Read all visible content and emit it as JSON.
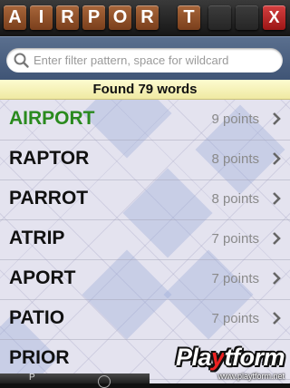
{
  "tiles": [
    "A",
    "I",
    "R",
    "P",
    "O",
    "R",
    "T"
  ],
  "close_label": "X",
  "search": {
    "placeholder": "Enter filter pattern, space for wildcard",
    "value": ""
  },
  "found_text": "Found 79 words",
  "words": [
    {
      "word": "AIRPORT",
      "points": "9 points",
      "highlight": true
    },
    {
      "word": "RAPTOR",
      "points": "8 points"
    },
    {
      "word": "PARROT",
      "points": "8 points"
    },
    {
      "word": "ATRIP",
      "points": "7 points"
    },
    {
      "word": "APORT",
      "points": "7 points"
    },
    {
      "word": "PATIO",
      "points": "7 points"
    },
    {
      "word": "PRIOR",
      "points": ""
    }
  ],
  "toolbar": {
    "partial_label": "P"
  },
  "watermark": {
    "logo_pre": "Pla",
    "logo_y": "y",
    "logo_post": "tform",
    "url": "www.playtform.net"
  },
  "colors": {
    "tile": "#9a5630",
    "best_word": "#2a8a1e",
    "close_tile": "#c62828"
  }
}
